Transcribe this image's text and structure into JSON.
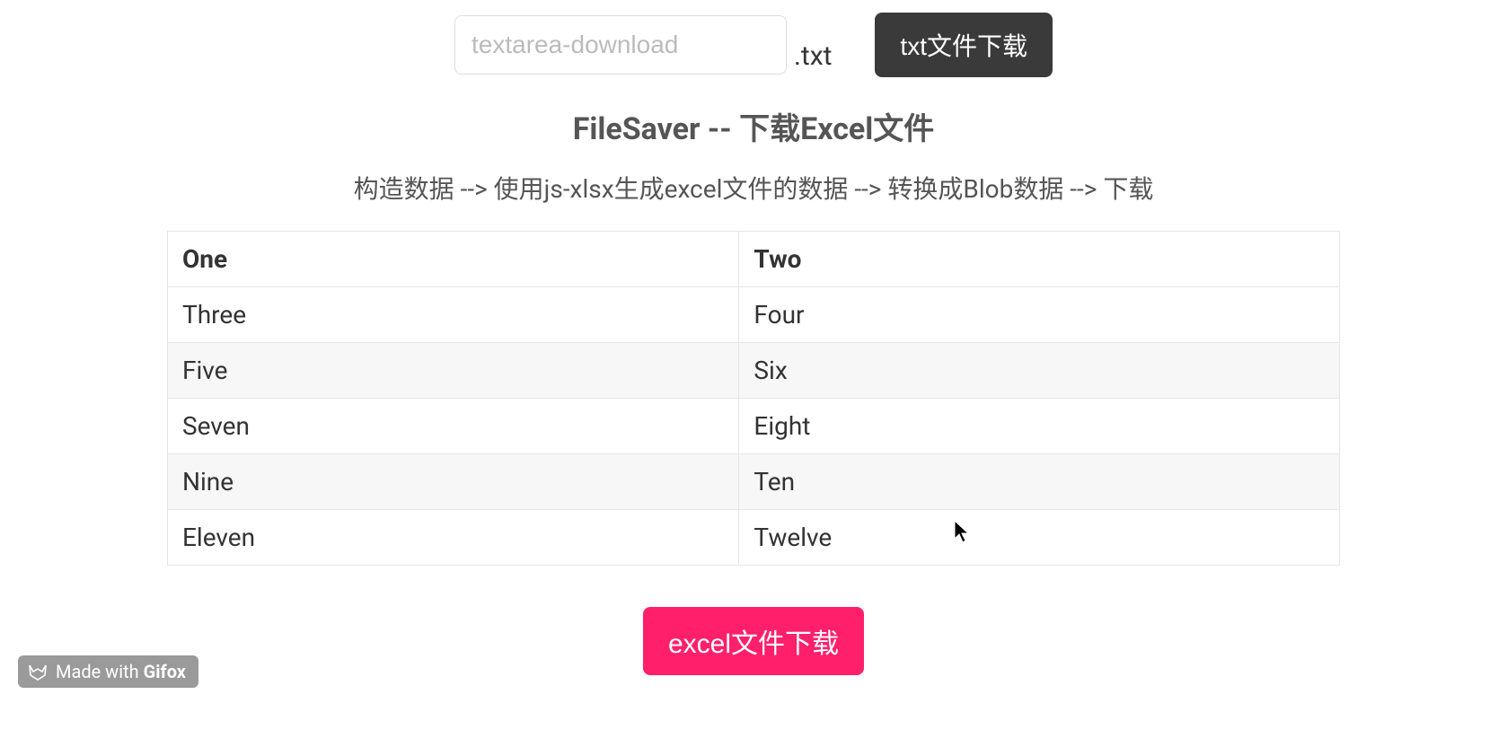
{
  "top": {
    "filename_placeholder": "textarea-download",
    "filename_value": "",
    "ext_label": ".txt",
    "txt_button_label": "txt文件下载"
  },
  "section": {
    "title": "FileSaver -- 下载Excel文件",
    "subtitle": "构造数据 --> 使用js-xlsx生成excel文件的数据 --> 转换成Blob数据 --> 下载"
  },
  "table": {
    "headers": [
      "One",
      "Two"
    ],
    "rows": [
      [
        "Three",
        "Four"
      ],
      [
        "Five",
        "Six"
      ],
      [
        "Seven",
        "Eight"
      ],
      [
        "Nine",
        "Ten"
      ],
      [
        "Eleven",
        "Twelve"
      ]
    ]
  },
  "excel_button_label": "excel文件下载",
  "badge": {
    "prefix": "Made with ",
    "brand": "Gifox"
  }
}
